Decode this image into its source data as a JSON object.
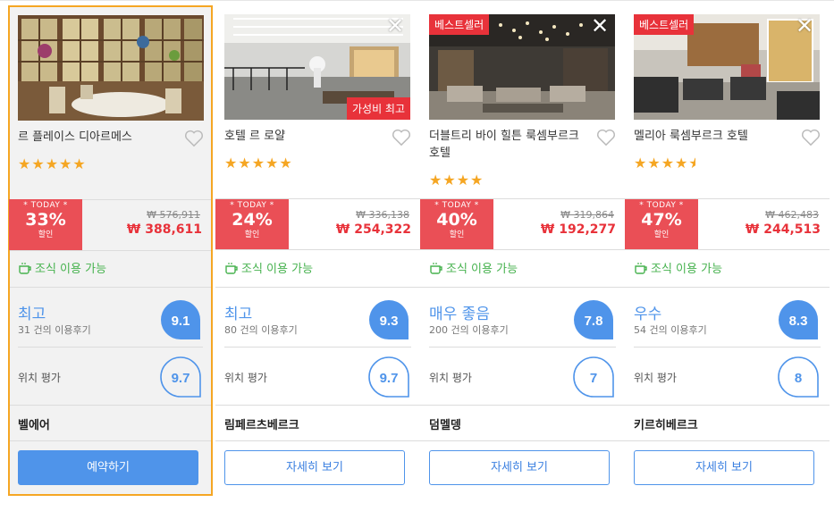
{
  "cards": [
    {
      "name": "르 플레이스 디아르메스",
      "stars": 5,
      "today": "* TODAY *",
      "discount": "33%",
      "discount_label": "할인",
      "orig_price": "₩ 576,911",
      "price": "₩ 388,611",
      "breakfast": "조식 이용 가능",
      "rating_label": "최고",
      "review_count": "31 건의 이용후기",
      "score": "9.1",
      "location_label": "위치 평가",
      "location_score": "9.7",
      "city": "벨에어",
      "button": "예약하기"
    },
    {
      "name": "호텔 르 로얄",
      "stars": 5,
      "badge": "가성비 최고",
      "today": "* TODAY *",
      "discount": "24%",
      "discount_label": "할인",
      "orig_price": "₩ 336,138",
      "price": "₩ 254,322",
      "breakfast": "조식 이용 가능",
      "rating_label": "최고",
      "review_count": "80 건의 이용후기",
      "score": "9.3",
      "location_label": "위치 평가",
      "location_score": "9.7",
      "city": "림페르츠베르크",
      "button": "자세히 보기"
    },
    {
      "name": "더블트리 바이 힐튼 룩셈부르크 호텔",
      "stars": 4,
      "badge": "베스트셀러",
      "today": "* TODAY *",
      "discount": "40%",
      "discount_label": "할인",
      "orig_price": "₩ 319,864",
      "price": "₩ 192,277",
      "breakfast": "조식 이용 가능",
      "rating_label": "매우 좋음",
      "review_count": "200 건의 이용후기",
      "score": "7.8",
      "location_label": "위치 평가",
      "location_score": "7",
      "city": "덤멜뎅",
      "button": "자세히 보기"
    },
    {
      "name": "멜리아 룩셈부르크 호텔",
      "stars": 4.5,
      "badge": "베스트셀러",
      "today": "* TODAY *",
      "discount": "47%",
      "discount_label": "할인",
      "orig_price": "₩ 462,483",
      "price": "₩ 244,513",
      "breakfast": "조식 이용 가능",
      "rating_label": "우수",
      "review_count": "54 건의 이용후기",
      "score": "8.3",
      "location_label": "위치 평가",
      "location_score": "8",
      "city": "키르히베르크",
      "button": "자세히 보기"
    }
  ],
  "colors": {
    "accent": "#4f94ea",
    "sale": "#ea4f56",
    "breakfast": "#46b24e",
    "stars": "#f5a623",
    "selected": "#f5a623"
  },
  "icons": {
    "close": "close-icon",
    "heart": "heart-icon",
    "cup": "coffee-cup-icon",
    "star": "star-icon"
  }
}
